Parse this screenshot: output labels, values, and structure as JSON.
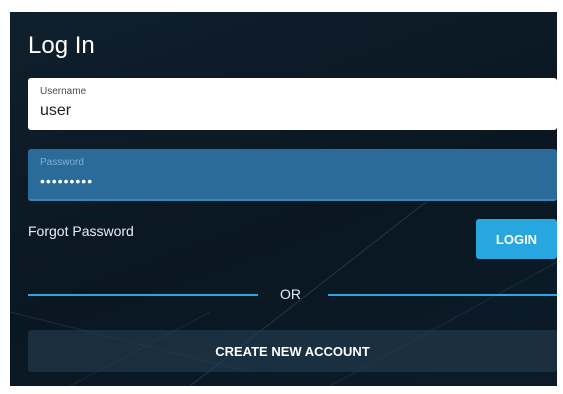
{
  "colors": {
    "panel_background": "#0d1c28",
    "accent": "#27a6e0",
    "password_field": "#2a6b9a",
    "text": "#ffffff"
  },
  "form": {
    "title": "Log In",
    "username": {
      "label": "Username",
      "value": "user"
    },
    "password": {
      "label": "Password",
      "value": "•••••••••"
    },
    "forgot_label": "Forgot Password",
    "login_label": "LOGIN",
    "divider_text": "OR",
    "create_label": "CREATE NEW ACCOUNT"
  }
}
